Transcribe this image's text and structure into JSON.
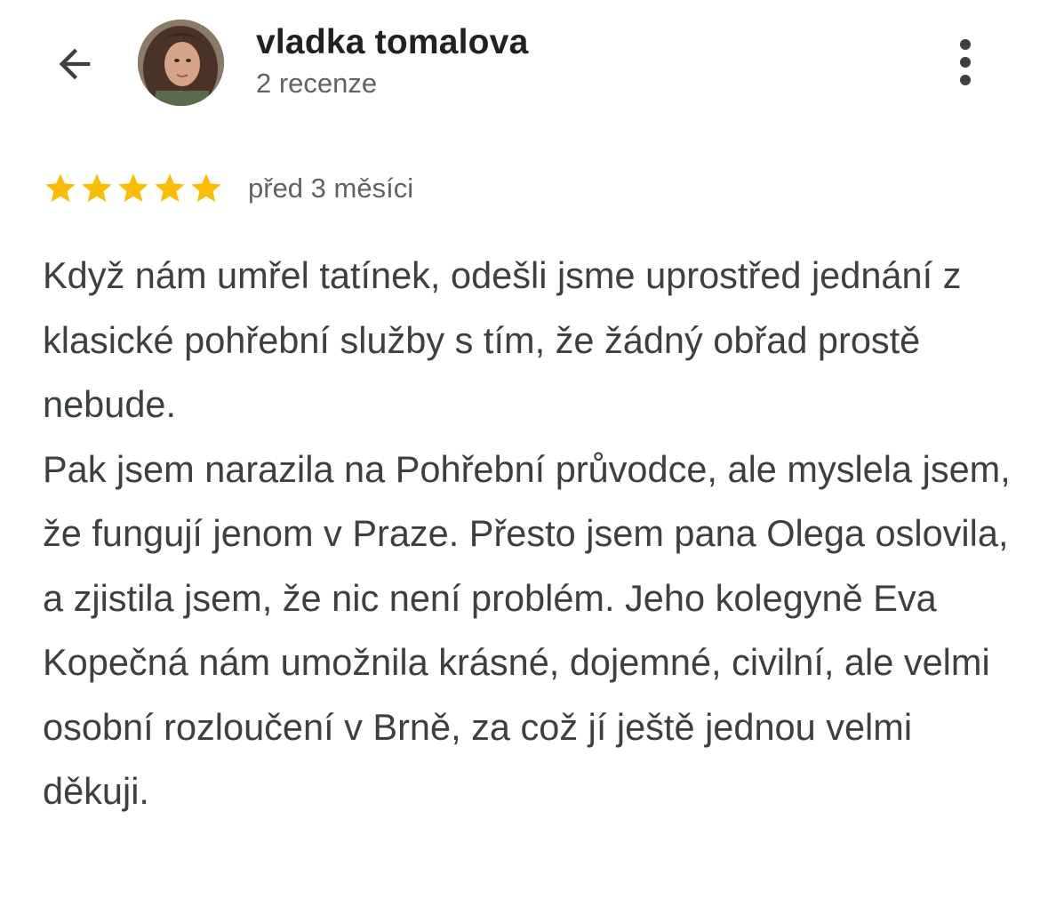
{
  "header": {
    "back_icon": "arrow-back-icon",
    "reviewer_name": "vladka tomalova",
    "review_count": "2 recenze",
    "more_icon": "more-vert-icon"
  },
  "review": {
    "rating": 5,
    "rating_max": 5,
    "star_color": "#fbbc04",
    "time_ago": "před 3 měsíci",
    "text": "Když nám umřel tatínek, odešli jsme uprostřed jednání z klasické pohřební služby s tím, že žádný obřad prostě nebude.\nPak jsem narazila na Pohřební průvodce, ale myslela jsem, že fungují jenom v Praze. Přesto jsem pana Olega oslovila, a zjistila jsem, že nic není problém. Jeho kolegyně Eva Kopečná nám umožnila krásné, dojemné, civilní, ale velmi osobní rozloučení v Brně, za což jí ještě jednou velmi děkuji."
  }
}
